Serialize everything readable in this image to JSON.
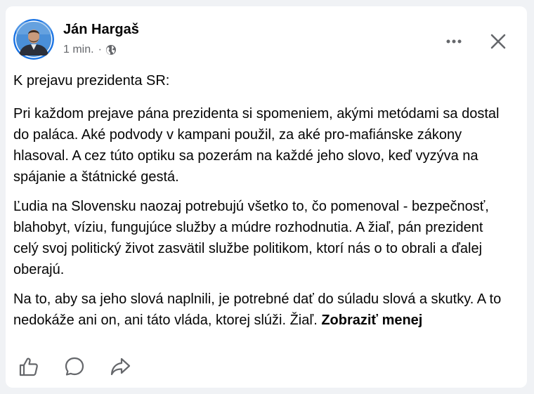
{
  "post": {
    "author": "Ján Hargaš",
    "time": "1 min.",
    "separator": "·",
    "audience_icon": "globe-icon",
    "paragraphs": [
      "K prejavu prezidenta SR:",
      "Pri každom prejave pána prezidenta si spomeniem, akými metódami sa dostal do paláca. Aké podvody v kampani použil, za aké pro-mafiánske zákony hlasoval. A cez túto optiku sa pozerám na každé jeho slovo, keď vyzýva na spájanie a štátnické gestá.",
      "Ľudia na Slovensku naozaj potrebujú všetko to, čo pomenoval - bezpečnosť, blahobyt, víziu, fungujúce služby a múdre rozhodnutia. A žiaľ, pán prezident celý svoj politický život  zasvätil službe politikom, ktorí nás o to obrali a ďalej oberajú.",
      "Na to, aby sa jeho slová naplnili, je potrebné dať do súladu slová a skutky. A to nedokáže ani on, ani táto vláda, ktorej slúži. Žiaľ."
    ],
    "show_less_label": "Zobraziť menej"
  },
  "header_icons": {
    "more": "more-horizontal-icon",
    "close": "close-icon"
  },
  "actions": [
    {
      "name": "like",
      "icon": "thumbs-up-icon"
    },
    {
      "name": "comment",
      "icon": "comment-icon"
    },
    {
      "name": "share",
      "icon": "share-icon"
    }
  ],
  "colors": {
    "background": "#f0f2f5",
    "card": "#ffffff",
    "text": "#050505",
    "secondary_text": "#65676b",
    "icon": "#65676b",
    "avatar_ring": "#1b74e4"
  }
}
